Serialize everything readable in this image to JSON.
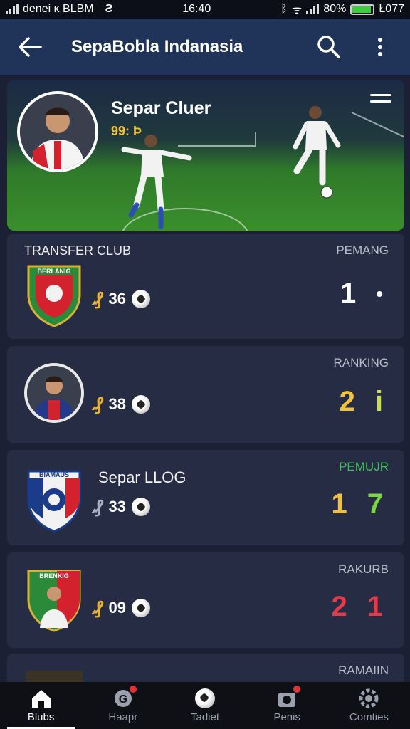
{
  "status_bar": {
    "left_text": "denei κ BLBM",
    "time": "16:40",
    "battery": "80%",
    "right_text": "Ł077"
  },
  "app_bar": {
    "title": "SepaBobla Indanasia"
  },
  "hero": {
    "title": "Separ Cluer",
    "score": "99: Þ"
  },
  "cards": [
    {
      "header": "TRANSFER CLUB",
      "tag": "PEMANG",
      "tag_color": "#b8bdcb",
      "stat": "36",
      "rank_a": "1",
      "rank_b": "•",
      "rank_a_color": "#ffffff",
      "rank_b_color": "#ffffff",
      "badge_text": "BERLANIG"
    },
    {
      "tag": "RANKING",
      "tag_color": "#b8bdcb",
      "stat": "38",
      "rank_a": "2",
      "rank_b": "i",
      "rank_a_color": "#f0c23a",
      "rank_b_color": "#c9e04a"
    },
    {
      "name": "Separ LLOG",
      "tag": "PEMUJR",
      "tag_color": "#3fbf5a",
      "stat": "33",
      "rank_a": "1",
      "rank_b": "7",
      "rank_a_color": "#f0c23a",
      "rank_b_color": "#7bd640",
      "badge_text": "BIAMAUS"
    },
    {
      "tag": "RAKURB",
      "tag_color": "#b8bdcb",
      "stat": "09",
      "rank_a": "2",
      "rank_b": "1",
      "rank_a_color": "#e23c4a",
      "rank_b_color": "#e23c4a",
      "badge_text": "BRENKIG"
    },
    {
      "tag": "RAMAIIN",
      "tag_color": "#b8bdcb"
    }
  ],
  "bottom_nav": [
    {
      "label": "Blubs",
      "icon": "home-icon"
    },
    {
      "label": "Haapr",
      "icon": "g-badge-icon"
    },
    {
      "label": "Tadiet",
      "icon": "soccer-ball-icon"
    },
    {
      "label": "Penis",
      "icon": "camera-icon"
    },
    {
      "label": "Comties",
      "icon": "gear-icon"
    }
  ]
}
